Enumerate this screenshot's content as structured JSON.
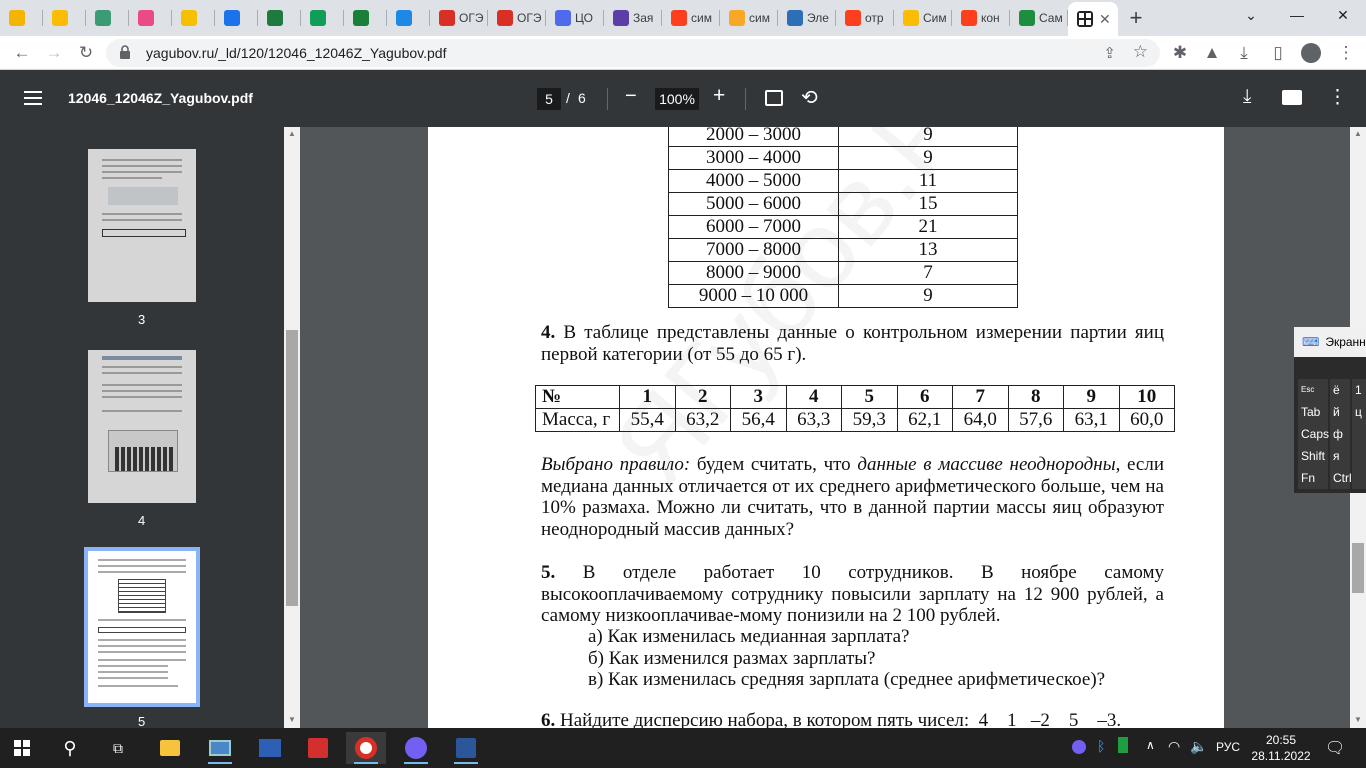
{
  "tabs": [
    {
      "label": "",
      "color": "#f4b400",
      "icon": "clock-icon"
    },
    {
      "label": "",
      "color": "#fbbc04",
      "icon": "yellow-bar-icon"
    },
    {
      "label": "",
      "color": "#3c9b74",
      "icon": "app-icon"
    },
    {
      "label": "",
      "color": "#e84a8a",
      "icon": "image-icon"
    },
    {
      "label": "",
      "color": "#f6c000",
      "icon": "dollar-icon"
    },
    {
      "label": "",
      "color": "#1a73e8",
      "icon": "chat-icon"
    },
    {
      "label": "",
      "color": "#1f7a3f",
      "icon": "slides-icon"
    },
    {
      "label": "",
      "color": "#0f9d58",
      "icon": "plus-icon"
    },
    {
      "label": "",
      "color": "#188038",
      "icon": "plus-icon"
    },
    {
      "label": "",
      "color": "#1e88e5",
      "icon": "at-icon"
    },
    {
      "label": "ОГЭ",
      "color": "#d93025",
      "icon": "gear-red-icon"
    },
    {
      "label": "ОГЭ",
      "color": "#d93025",
      "icon": "gear-red-icon"
    },
    {
      "label": "ЦО",
      "color": "#4f6bed",
      "icon": "play-icon"
    },
    {
      "label": "Зая",
      "color": "#5b3fa6",
      "icon": "form-icon"
    },
    {
      "label": "сим",
      "color": "#fc3f1d",
      "icon": "yandex-icon"
    },
    {
      "label": "сим",
      "color": "#f9a825",
      "icon": "mountain-icon"
    },
    {
      "label": "Эле",
      "color": "#2c6fb7",
      "icon": "cube-icon"
    },
    {
      "label": "отр",
      "color": "#fc3f1d",
      "icon": "yandex-icon"
    },
    {
      "label": "Сим",
      "color": "#fbbc04",
      "icon": "yellow-bar-icon"
    },
    {
      "label": "кон",
      "color": "#fc3f1d",
      "icon": "yandex-icon"
    },
    {
      "label": "Сам",
      "color": "#1e8e3e",
      "icon": "check-icon"
    }
  ],
  "active_tab_icon": "grid-icon",
  "url": "yagubov.ru/_ld/120/12046_12046Z_Yagubov.pdf",
  "pdf": {
    "filename": "12046_12046Z_Yagubov.pdf",
    "page_current": "5",
    "page_sep": "/",
    "page_total": "6",
    "zoom": "100%"
  },
  "thumbnails": [
    {
      "num": "3"
    },
    {
      "num": "4"
    },
    {
      "num": "5"
    }
  ],
  "table1": [
    [
      "2000 – 3000",
      "9"
    ],
    [
      "3000 – 4000",
      "9"
    ],
    [
      "4000 – 5000",
      "11"
    ],
    [
      "5000 – 6000",
      "15"
    ],
    [
      "6000 – 7000",
      "21"
    ],
    [
      "7000 – 8000",
      "13"
    ],
    [
      "8000 – 9000",
      "7"
    ],
    [
      "9000 – 10 000",
      "9"
    ]
  ],
  "task4": {
    "num": "4.",
    "text": " В таблице представлены данные о контрольном измерении партии яиц первой категории (от 55 до 65 г).",
    "header": [
      "№",
      "1",
      "2",
      "3",
      "4",
      "5",
      "6",
      "7",
      "8",
      "9",
      "10"
    ],
    "row": [
      "Масса, г",
      "55,4",
      "63,2",
      "56,4",
      "63,3",
      "59,3",
      "62,1",
      "64,0",
      "57,6",
      "63,1",
      "60,0"
    ],
    "rule_label": "Выбрано правило:",
    "rule_text1": " будем считать, что ",
    "rule_italic": "данные в массиве неоднородны",
    "rule_text2": ", если медиана данных отличается от их среднего арифметического больше, чем на 10% размаха. Можно ли считать, что в данной партии массы яиц образуют неоднородный массив данных?"
  },
  "task5": {
    "num": "5.",
    "text": " В отделе работает 10 сотрудников. В ноябре самому высокооплачиваемому сотруднику повысили зарплату на 12 900 рублей, а самому низкооплачивае-мому понизили на 2 100 рублей.",
    "a": "а) Как изменилась медианная зарплата?",
    "b": "б) Как изменился размах зарплаты?",
    "c": "в) Как изменилась средняя зарплата (среднее арифметическое)?"
  },
  "task6": {
    "num": "6.",
    "text": " Найдите дисперсию набора, в котором пять чисел:  4    1   –2    5    –3."
  },
  "watermark": "ЯГубов.РФ",
  "keyboard": {
    "title": "Экранна",
    "rows": [
      [
        "Esc",
        "ё",
        "1"
      ],
      [
        "Tab",
        "й",
        "ц"
      ],
      [
        "Caps",
        "ф",
        ""
      ],
      [
        "Shift",
        "я",
        ""
      ],
      [
        "Fn",
        "Ctrl",
        ""
      ]
    ]
  },
  "tray": {
    "lang": "РУС",
    "time": "20:55",
    "date": "28.11.2022"
  }
}
